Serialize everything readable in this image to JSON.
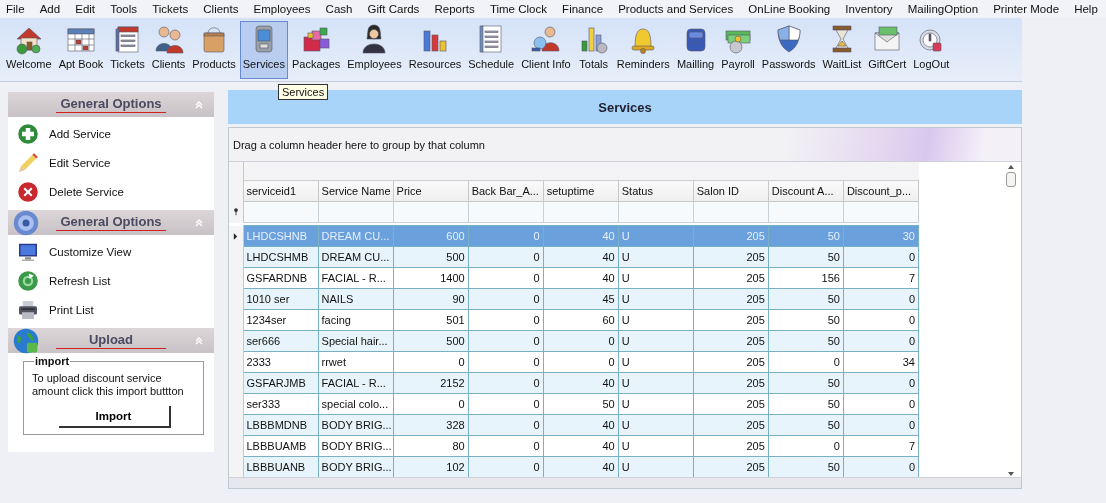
{
  "menu": [
    "File",
    "Add",
    "Edit",
    "Tools",
    "Tickets",
    "Clients",
    "Employees",
    "Cash",
    "Gift Cards",
    "Reports",
    "Time Clock",
    "Finance",
    "Products and Services",
    "OnLine Booking",
    "Inventory",
    "MailingOption",
    "Printer Mode",
    "Help"
  ],
  "toolbar": [
    {
      "label": "Welcome",
      "selected": false
    },
    {
      "label": "Apt Book",
      "selected": false
    },
    {
      "label": "Tickets",
      "selected": false
    },
    {
      "label": "Clients",
      "selected": false
    },
    {
      "label": "Products",
      "selected": false
    },
    {
      "label": "Services",
      "selected": true
    },
    {
      "label": "Packages",
      "selected": false
    },
    {
      "label": "Employees",
      "selected": false
    },
    {
      "label": "Resources",
      "selected": false
    },
    {
      "label": "Schedule",
      "selected": false
    },
    {
      "label": "Client Info",
      "selected": false
    },
    {
      "label": "Totals",
      "selected": false
    },
    {
      "label": "Reminders",
      "selected": false
    },
    {
      "label": "Mailling",
      "selected": false
    },
    {
      "label": "Payroll",
      "selected": false
    },
    {
      "label": "Passwords",
      "selected": false
    },
    {
      "label": "WaitList",
      "selected": false
    },
    {
      "label": "GiftCert",
      "selected": false
    },
    {
      "label": "LogOut",
      "selected": false
    }
  ],
  "tooltip": "Services",
  "sidebar": {
    "sections": [
      {
        "title": "General Options",
        "items": [
          "Add Service",
          "Edit Service",
          "Delete Service"
        ]
      },
      {
        "title": "General Options",
        "items": [
          "Customize View",
          "Refresh List",
          "Print List"
        ]
      },
      {
        "title": "Upload",
        "import_box": {
          "legend": "import",
          "text": "To upload discount service amount  click  this  import buttton",
          "button": "Import"
        }
      }
    ]
  },
  "panel": {
    "title": "Services",
    "group_hint": "Drag a column header here to group by that column",
    "table": {
      "columns": [
        {
          "label": "serviceid1",
          "numeric": false
        },
        {
          "label": "Service Name",
          "numeric": false
        },
        {
          "label": "Price",
          "numeric": true
        },
        {
          "label": "Back Bar_A...",
          "numeric": true
        },
        {
          "label": "setuptime",
          "numeric": true
        },
        {
          "label": "Status",
          "numeric": false
        },
        {
          "label": "Salon ID",
          "numeric": true
        },
        {
          "label": "Discount A...",
          "numeric": true
        },
        {
          "label": "Discount_p...",
          "numeric": true
        }
      ],
      "rows": [
        {
          "selected": true,
          "cells": [
            "LHDCSHNB",
            "DREAM CU...",
            "600",
            "0",
            "40",
            "U",
            "205",
            "50",
            "30"
          ]
        },
        {
          "selected": false,
          "cells": [
            "LHDCSHMB",
            "DREAM CU...",
            "500",
            "0",
            "40",
            "U",
            "205",
            "50",
            "0"
          ]
        },
        {
          "selected": false,
          "cells": [
            "GSFARDNB",
            "FACIAL  - R...",
            "1400",
            "0",
            "40",
            "U",
            "205",
            "156",
            "7"
          ]
        },
        {
          "selected": false,
          "cells": [
            "1010 ser",
            "NAILS",
            "90",
            "0",
            "45",
            "U",
            "205",
            "50",
            "0"
          ]
        },
        {
          "selected": false,
          "cells": [
            "1234ser",
            "facing",
            "501",
            "0",
            "60",
            "U",
            "205",
            "50",
            "0"
          ]
        },
        {
          "selected": false,
          "cells": [
            "ser666",
            " Special hair...",
            "500",
            "0",
            "0",
            "U",
            "205",
            "50",
            "0"
          ]
        },
        {
          "selected": false,
          "cells": [
            "2333",
            "rrwet",
            "0",
            "0",
            "0",
            "U",
            "205",
            "0",
            "34"
          ]
        },
        {
          "selected": false,
          "cells": [
            "GSFARJMB",
            "FACIAL  - R...",
            "2152",
            "0",
            "40",
            "U",
            "205",
            "50",
            "0"
          ]
        },
        {
          "selected": false,
          "cells": [
            "ser333",
            "special colo...",
            "0",
            "0",
            "50",
            "U",
            "205",
            "50",
            "0"
          ]
        },
        {
          "selected": false,
          "cells": [
            "LBBBMDNB",
            "BODY BRIG...",
            "328",
            "0",
            "40",
            "U",
            "205",
            "50",
            "0"
          ]
        },
        {
          "selected": false,
          "cells": [
            "LBBBUAMB",
            "BODY BRIG...",
            "80",
            "0",
            "40",
            "U",
            "205",
            "0",
            "7"
          ]
        },
        {
          "selected": false,
          "cells": [
            "LBBBUANB",
            "BODY BRIG...",
            "102",
            "0",
            "40",
            "U",
            "205",
            "50",
            "0"
          ]
        }
      ]
    }
  }
}
